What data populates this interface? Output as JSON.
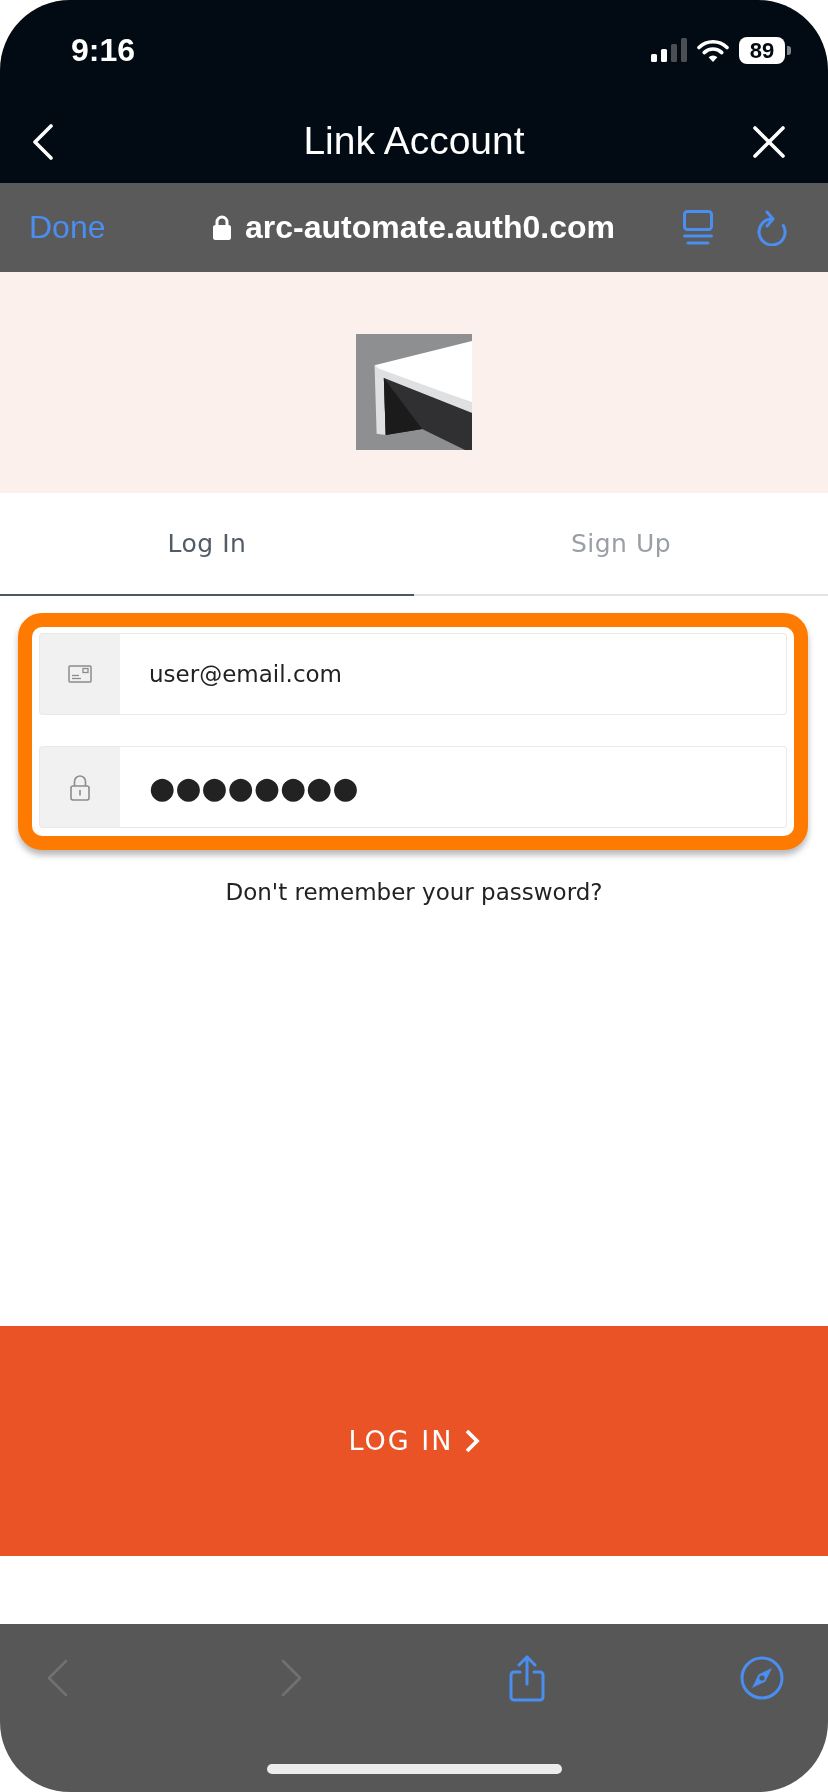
{
  "status_bar": {
    "time": "9:16",
    "battery": "89"
  },
  "nav_bar": {
    "title": "Link Account"
  },
  "browser_bar": {
    "done_button": "Done",
    "url": "arc-automate.auth0.com"
  },
  "tabs": [
    {
      "label": "Log In",
      "selected": true
    },
    {
      "label": "Sign Up",
      "selected": false
    }
  ],
  "login_form": {
    "fields": [
      {
        "kind": "email",
        "value": "user@email.com"
      },
      {
        "kind": "password",
        "value": "●●●●●●●●"
      }
    ],
    "forgot_password": "Don't remember your password?",
    "submit_button": "LOG IN"
  },
  "toolbar": [
    {
      "kind": "back",
      "disabled": true
    },
    {
      "kind": "forward",
      "disabled": true
    },
    {
      "kind": "share",
      "disabled": false
    },
    {
      "kind": "compass",
      "disabled": false
    }
  ]
}
